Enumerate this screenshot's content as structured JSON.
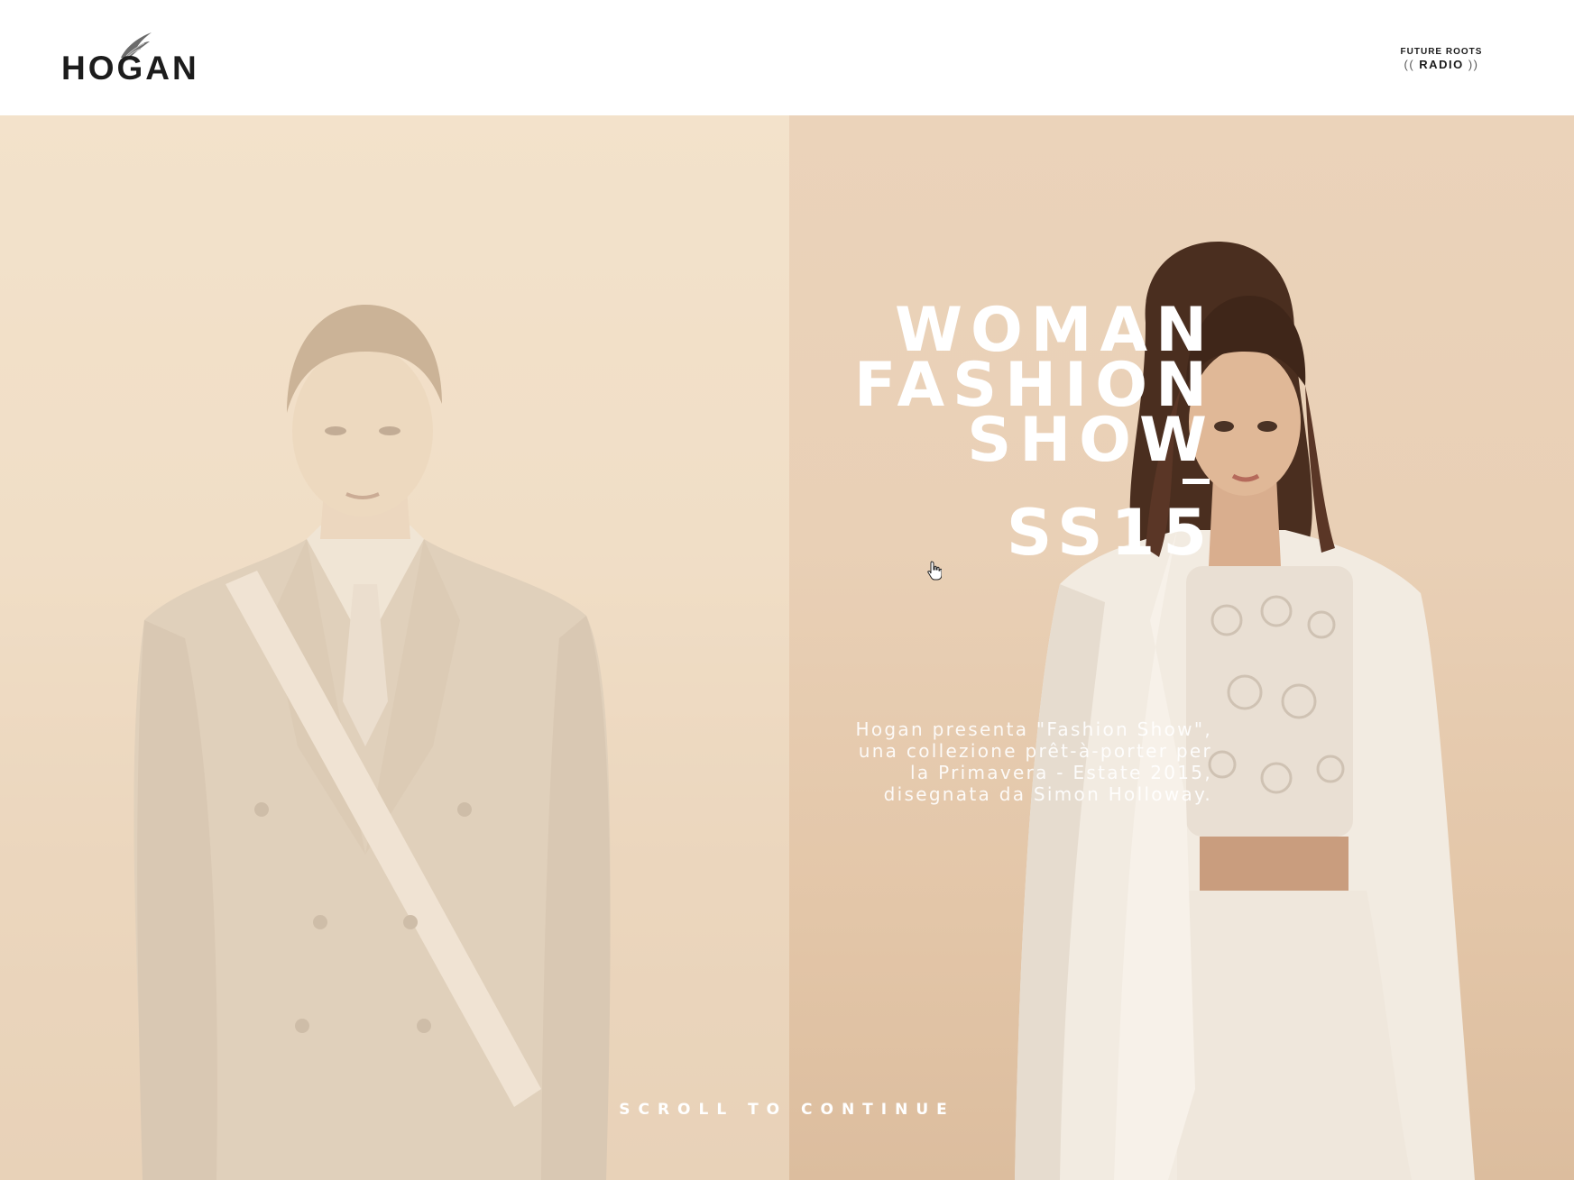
{
  "header": {
    "logo_text": "HOGAN",
    "radio_top": "FUTURE ROOTS",
    "radio_bottom": "RADIO",
    "radio_paren_open": "((",
    "radio_paren_close": "))"
  },
  "hero": {
    "title_lines": [
      "WOMAN",
      "FASHION",
      "SHOW"
    ],
    "season": "SS15",
    "description_lines": [
      "Hogan presenta \"Fashion Show\",",
      "una collezione prêt-à-porter per",
      "la Primavera - Estate 2015,",
      "disegnata da Simon Holloway."
    ],
    "scroll_label": "SCROLL TO CONTINUE"
  },
  "icons": [
    "hogan-wing-icon",
    "hand-cursor-icon"
  ],
  "colors": {
    "header_bg": "#ffffff",
    "logo": "#1c1c1c",
    "left_panel": "#efdcc4",
    "right_panel": "#e9d0b6",
    "overlay_text": "#ffffff"
  }
}
